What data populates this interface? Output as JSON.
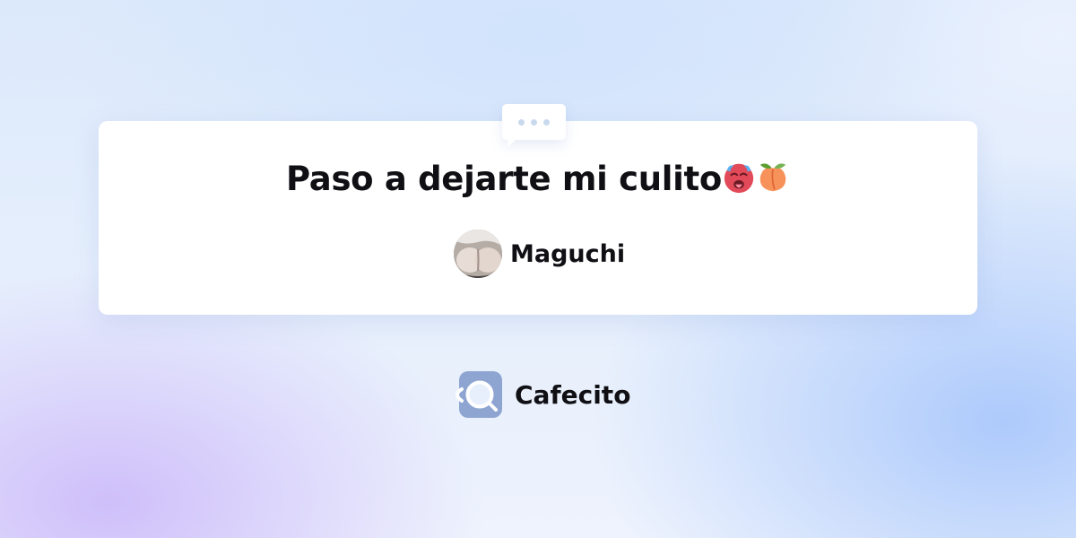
{
  "card": {
    "message": "Paso a dejarte mi culito",
    "emojis": [
      "hot-face-emoji",
      "peach-emoji"
    ]
  },
  "author": {
    "name": "Maguchi",
    "avatar": "avatar-photo"
  },
  "brand": {
    "name": "Cafecito",
    "logo": "cafecito-cup-logo",
    "color": "#8ea5d2"
  },
  "colors": {
    "text": "#0f0f14",
    "card_background": "#ffffff",
    "bubble_dots": "#c9d9ee"
  }
}
